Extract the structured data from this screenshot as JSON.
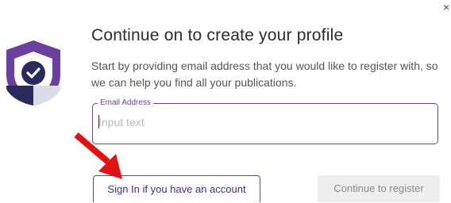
{
  "dialog": {
    "close_label": "×",
    "title": "Continue on to create your profile",
    "description": "Start by providing email address that you would like to register with, so we can help you find all your publications.",
    "email_field": {
      "label": "Email Address",
      "placeholder": "Input text",
      "value": ""
    },
    "buttons": {
      "sign_in": "Sign In if you have an account",
      "continue": "Continue to register"
    }
  },
  "colors": {
    "accent": "#6b3fa0",
    "shield_dark": "#2a2a5e",
    "shield_light": "#dcdce6",
    "annotation_arrow": "#e31212"
  }
}
